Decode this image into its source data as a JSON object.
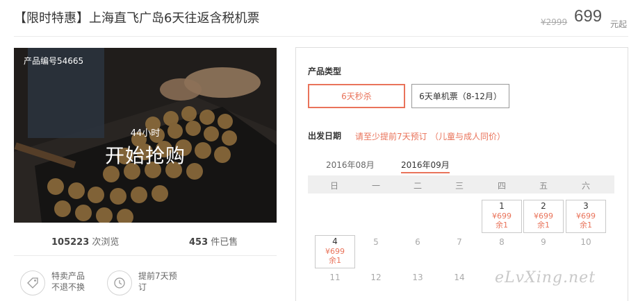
{
  "header": {
    "title": "【限时特惠】上海直飞广岛6天往返含税机票",
    "price_original": "¥2999",
    "price_current": "699",
    "price_unit": "元起"
  },
  "photo": {
    "product_no": "产品编号54665",
    "countdown": "44小时",
    "start_text": "开始抢购"
  },
  "stats": {
    "views_count": "105223",
    "views_label": "次浏览",
    "sold_count": "453",
    "sold_label": "件已售"
  },
  "features": [
    {
      "icon": "tag-icon",
      "line1": "特卖产品",
      "line2": "不退不换"
    },
    {
      "icon": "clock-icon",
      "line1": "提前7天预",
      "line2": "订"
    }
  ],
  "booking": {
    "type_label": "产品类型",
    "types": [
      "6天秒杀",
      "6天单机票（8-12月）"
    ],
    "selected_type": "6天秒杀",
    "date_label": "出发日期",
    "notice_1": "请至少提前7天预订",
    "notice_2": "（儿童与成人同价）",
    "months": [
      "2016年08月",
      "2016年09月"
    ],
    "active_month": "2016年09月",
    "weekdays": [
      "日",
      "一",
      "二",
      "三",
      "四",
      "五",
      "六"
    ],
    "days": [
      {
        "day": "1",
        "price": "¥699",
        "left": "余1"
      },
      {
        "day": "2",
        "price": "¥699",
        "left": "余1"
      },
      {
        "day": "3",
        "price": "¥699",
        "left": "余1"
      },
      {
        "day": "4",
        "price": "¥699",
        "left": "余1"
      },
      {
        "day": "5"
      },
      {
        "day": "6"
      },
      {
        "day": "7"
      },
      {
        "day": "8"
      },
      {
        "day": "9"
      },
      {
        "day": "10"
      },
      {
        "day": "11"
      },
      {
        "day": "12"
      },
      {
        "day": "13"
      },
      {
        "day": "14"
      }
    ]
  },
  "watermark": "eLvXing.net",
  "colors": {
    "accent": "#e9735a",
    "text": "#333333",
    "muted": "#aaaaaa"
  }
}
